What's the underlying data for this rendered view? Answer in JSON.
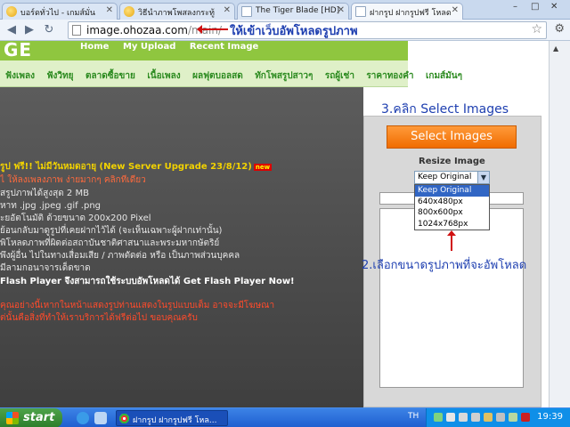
{
  "browser": {
    "tabs": [
      {
        "label": "บอร์ดทั่วไป - เกมส์มั่น",
        "icon": "globe-icon",
        "active": false
      },
      {
        "label": "วิธีนำภาพโพสลงกระทู้",
        "icon": "globe-icon",
        "active": false
      },
      {
        "label": "The Tiger Blade [HD]",
        "icon": "page-icon",
        "active": false
      },
      {
        "label": "ฝากรูป ฝากรูปฟรี โหลด",
        "icon": "page-icon",
        "active": true
      }
    ],
    "window_controls": [
      "–",
      "□",
      "✕"
    ],
    "address": {
      "host": "image.ohozaa.com",
      "path": "/main/"
    },
    "star_icon": "star-icon",
    "wrench_icon": "wrench-icon"
  },
  "annotations": {
    "address_note": "ให้เข้าเว็บอัพโหลดรูปภาพ",
    "step3": "3.คลิก Select Images",
    "step2": "2.เลือกขนาดรูปภาพที่จะอัพโหลด"
  },
  "site": {
    "logo": "GE",
    "top_nav": [
      "Home",
      "My Upload",
      "Recent Image"
    ],
    "menu": [
      "ฟังเพลง",
      "ฟังวิทยุ",
      "ตลาดซื้อขาย",
      "เนื้อเพลง",
      "ผลฟุตบอลสด",
      "ทักโพสรูปสาวๆ",
      "รถผู้เช่า",
      "ราคาทองคำ",
      "เกมส์มันๆ"
    ],
    "info_lines": [
      {
        "text": "รูป ฟรี!! ไม่มีวันหมดอายุ (New Server Upgrade 23/8/12)",
        "style": "yellow",
        "badge": "new"
      },
      {
        "text": "ไ ให้ลงเพลงภาพ ง่ายมากๆ คลิกทีเดียว",
        "style": "orange"
      },
      {
        "text": "สรูปภาพได้สูงสุด 2 MB",
        "style": "plain"
      },
      {
        "text": "หาท .jpg .jpeg .gif .png",
        "style": "plain"
      },
      {
        "text": "ะยอัตโนมัติ ด้วยขนาด 200x200 Pixel",
        "style": "plain"
      },
      {
        "text": "ย้อนกลับมาดูรูปที่เคยฝากไว้ได้ (จะเห็นเฉพาะผู้ฝากเท่านั้น)",
        "style": "plain"
      },
      {
        "text": "พิโหลดภาพที่ผิดต่อสถาบันชาติศาสนาและพระมหากษัตริย์",
        "style": "plain"
      },
      {
        "text": "พึงผู้อื่น ไปในทางเสื่อมเสีย / ภาพตัดต่อ หรือ เป็นภาพส่วนบุคคล",
        "style": "plain"
      },
      {
        "text": "มีลามกอนาจารเด็ดขาด",
        "style": "plain"
      },
      {
        "text": "Flash Player จึงสามารถใช้ระบบอัพโหลดได้ Get Flash Player Now!",
        "style": "bold"
      },
      {
        "text": "คุณอย่างนี้เหากในหน้าแสดงรูปท่านแสดงในรูปแบบเต็ม อาจจะมีโฆษณา",
        "style": "red"
      },
      {
        "text": "ต่นั้นคือสิ่งที่ทำให้เราบริการได้ฟรีต่อไป ขอบคุณครับ",
        "style": "red"
      }
    ],
    "select_button": "Select Images",
    "resize_label": "Resize Image",
    "resize_selected": "Keep Original",
    "resize_options": [
      "Keep Original",
      "640x480px",
      "800x600px",
      "1024x768px"
    ]
  },
  "taskbar": {
    "start_label": "start",
    "task_label": "ฝากรูป ฝากรูปฟรี โหล...",
    "language": "TH",
    "clock": "19:39"
  },
  "colors": {
    "brand_green": "#8fc63f",
    "select_orange": "#f06c00",
    "annotation_blue": "#1e3fb0",
    "highlight": "#3166c4"
  }
}
